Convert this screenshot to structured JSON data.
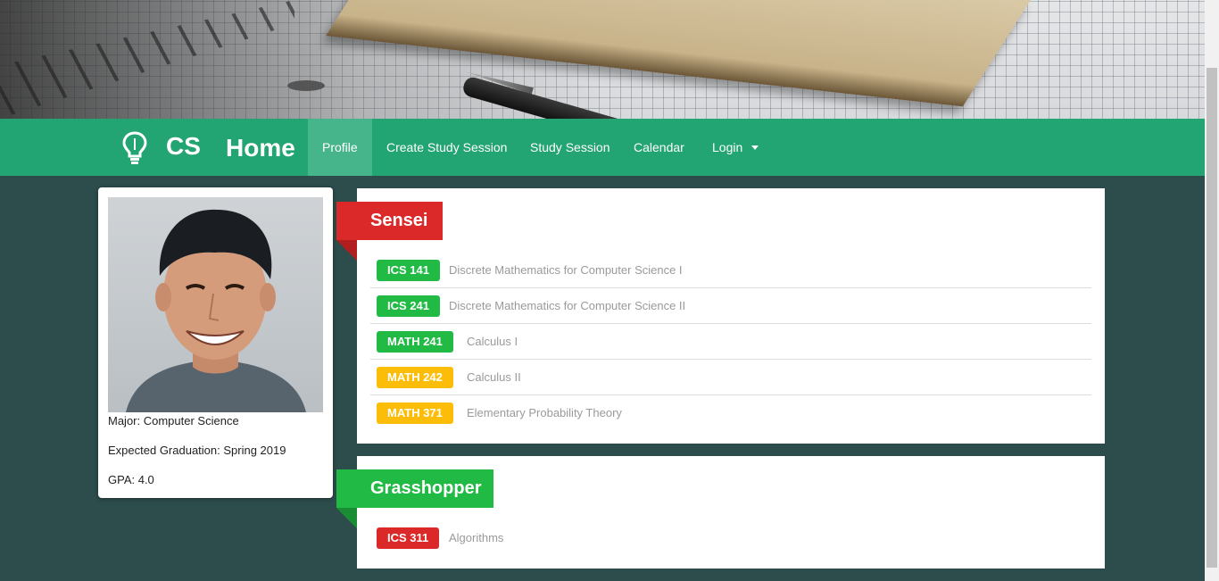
{
  "nav": {
    "brand_icon": "lightbulb-icon",
    "brand_cs": "CS",
    "brand_home": "Home",
    "items": [
      {
        "label": "Profile",
        "active": true
      },
      {
        "label": "Create Study Session",
        "active": false
      },
      {
        "label": "Study Session",
        "active": false
      },
      {
        "label": "Calendar",
        "active": false
      },
      {
        "label": "Login",
        "active": false,
        "dropdown": true
      }
    ]
  },
  "profile": {
    "major": "Major: Computer Science",
    "graduation": "Expected Graduation: Spring 2019",
    "gpa": "GPA: 4.0"
  },
  "sensei": {
    "title": "Sensei",
    "courses": [
      {
        "code": "ICS 141",
        "name": "Discrete Mathematics for Computer Science I",
        "color": "#21ba45"
      },
      {
        "code": "ICS 241",
        "name": "Discrete Mathematics for Computer Science II",
        "color": "#21ba45"
      },
      {
        "code": "MATH 241",
        "name": "Calculus I",
        "color": "#21ba45"
      },
      {
        "code": "MATH 242",
        "name": "Calculus II",
        "color": "#fbbd08"
      },
      {
        "code": "MATH 371",
        "name": "Elementary Probability Theory",
        "color": "#fbbd08"
      }
    ]
  },
  "grasshopper": {
    "title": "Grasshopper",
    "courses": [
      {
        "code": "ICS 311",
        "name": "Algorithms",
        "color": "#db2828"
      }
    ]
  },
  "colors": {
    "navbar": "#23a473",
    "nav_active": "#46b58b",
    "page_bg": "#2d4c4c",
    "ribbon_red": "#db2828",
    "ribbon_green": "#21ba45"
  }
}
